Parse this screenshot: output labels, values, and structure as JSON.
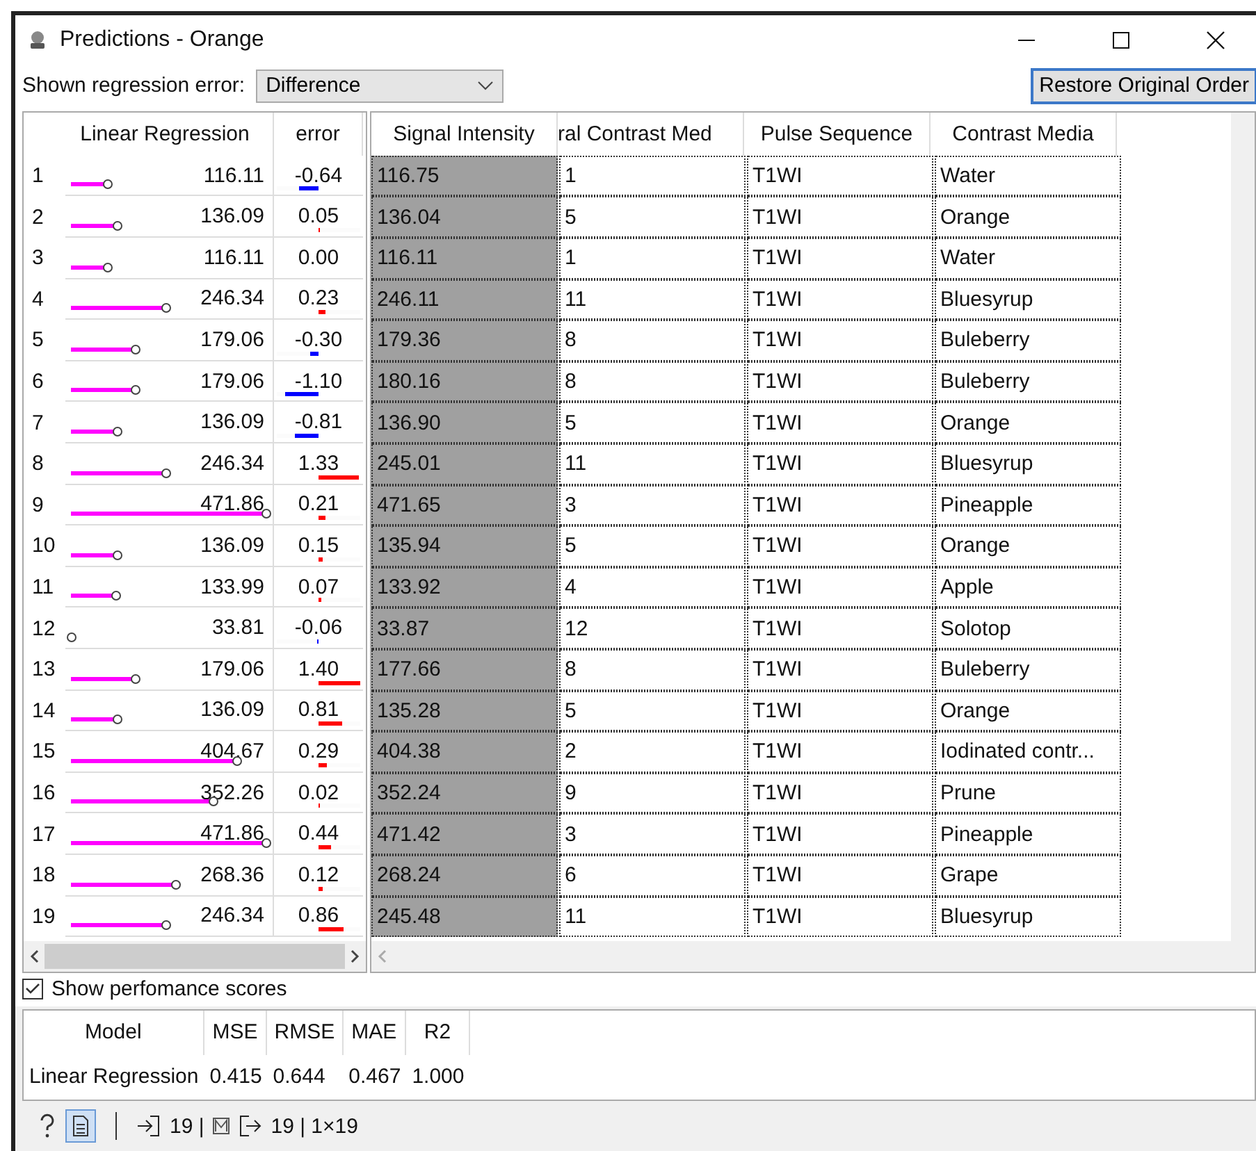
{
  "window": {
    "title": "Predictions - Orange"
  },
  "toolbar": {
    "label": "Shown regression error:",
    "dropdown": "Difference",
    "button": "Restore Original Order"
  },
  "predictions_table": {
    "columns": [
      "Linear Regression",
      "error"
    ],
    "rows": [
      {
        "index": "1",
        "prediction": "116.11",
        "level": 0.188,
        "error": "-0.64",
        "error_bar": {
          "kind": "negative",
          "level": 0.457,
          "color": "#0000ff"
        }
      },
      {
        "index": "2",
        "prediction": "136.09",
        "level": 0.233,
        "error": "0.05",
        "error_bar": {
          "kind": "positive",
          "level": 0.036,
          "color": "#ff0000"
        }
      },
      {
        "index": "3",
        "prediction": "116.11",
        "level": 0.188,
        "error": "0.00"
      },
      {
        "index": "4",
        "prediction": "246.34",
        "level": 0.485,
        "error": "0.23",
        "error_bar": {
          "kind": "positive",
          "level": 0.164,
          "color": "#ff0000"
        }
      },
      {
        "index": "5",
        "prediction": "179.06",
        "level": 0.332,
        "error": "-0.30",
        "error_bar": {
          "kind": "negative",
          "level": 0.214,
          "color": "#0000ff"
        }
      },
      {
        "index": "6",
        "prediction": "179.06",
        "level": 0.332,
        "error": "-1.10",
        "error_bar": {
          "kind": "negative",
          "level": 0.786,
          "color": "#0000ff"
        }
      },
      {
        "index": "7",
        "prediction": "136.09",
        "level": 0.233,
        "error": "-0.81",
        "error_bar": {
          "kind": "negative",
          "level": 0.579,
          "color": "#0000ff"
        }
      },
      {
        "index": "8",
        "prediction": "246.34",
        "level": 0.485,
        "error": "1.33",
        "error_bar": {
          "kind": "positive",
          "level": 0.95,
          "color": "#ff0000"
        }
      },
      {
        "index": "9",
        "prediction": "471.86",
        "level": 1,
        "error": "0.21",
        "error_bar": {
          "kind": "positive",
          "level": 0.15,
          "color": "#ff0000"
        }
      },
      {
        "index": "10",
        "prediction": "136.09",
        "level": 0.233,
        "error": "0.15",
        "error_bar": {
          "kind": "positive",
          "level": 0.107,
          "color": "#ff0000"
        }
      },
      {
        "index": "11",
        "prediction": "133.99",
        "level": 0.229,
        "error": "0.07",
        "error_bar": {
          "kind": "positive",
          "level": 0.05,
          "color": "#ff0000"
        }
      },
      {
        "index": "12",
        "prediction": "33.81",
        "level": 0,
        "error": "-0.06",
        "error_bar": {
          "kind": "negative",
          "level": 0.043,
          "color": "#0000ff"
        }
      },
      {
        "index": "13",
        "prediction": "179.06",
        "level": 0.332,
        "error": "1.40",
        "error_bar": {
          "kind": "positive",
          "level": 1,
          "color": "#ff0000"
        }
      },
      {
        "index": "14",
        "prediction": "136.09",
        "level": 0.233,
        "error": "0.81",
        "error_bar": {
          "kind": "positive",
          "level": 0.579,
          "color": "#ff0000"
        }
      },
      {
        "index": "15",
        "prediction": "404.67",
        "level": 0.847,
        "error": "0.29",
        "error_bar": {
          "kind": "positive",
          "level": 0.207,
          "color": "#ff0000"
        }
      },
      {
        "index": "16",
        "prediction": "352.26",
        "level": 0.727,
        "error": "0.02",
        "error_bar": {
          "kind": "positive",
          "level": 0.014,
          "color": "#ff0000"
        }
      },
      {
        "index": "17",
        "prediction": "471.86",
        "level": 1,
        "error": "0.44",
        "error_bar": {
          "kind": "positive",
          "level": 0.314,
          "color": "#ff0000"
        }
      },
      {
        "index": "18",
        "prediction": "268.36",
        "level": 0.535,
        "error": "0.12",
        "error_bar": {
          "kind": "positive",
          "level": 0.086,
          "color": "#ff0000"
        }
      },
      {
        "index": "19",
        "prediction": "246.34",
        "level": 0.485,
        "error": "0.86",
        "error_bar": {
          "kind": "positive",
          "level": 0.614,
          "color": "#ff0000"
        }
      }
    ]
  },
  "data_table": {
    "columns": [
      "Signal Intensity",
      "ral Contrast Med",
      "Pulse Sequence",
      "Contrast Media"
    ],
    "rows": [
      {
        "selected": true,
        "cells": [
          "116.75",
          "1",
          "T1WI",
          "Water"
        ]
      },
      {
        "selected": true,
        "cells": [
          "136.04",
          "5",
          "T1WI",
          "Orange"
        ]
      },
      {
        "selected": true,
        "cells": [
          "116.11",
          "1",
          "T1WI",
          "Water"
        ]
      },
      {
        "selected": true,
        "cells": [
          "246.11",
          "11",
          "T1WI",
          "Bluesyrup"
        ]
      },
      {
        "selected": true,
        "cells": [
          "179.36",
          "8",
          "T1WI",
          "Buleberry"
        ]
      },
      {
        "selected": true,
        "cells": [
          "180.16",
          "8",
          "T1WI",
          "Buleberry"
        ]
      },
      {
        "selected": true,
        "cells": [
          "136.90",
          "5",
          "T1WI",
          "Orange"
        ]
      },
      {
        "selected": true,
        "cells": [
          "245.01",
          "11",
          "T1WI",
          "Bluesyrup"
        ]
      },
      {
        "selected": true,
        "cells": [
          "471.65",
          "3",
          "T1WI",
          "Pineapple"
        ]
      },
      {
        "selected": true,
        "cells": [
          "135.94",
          "5",
          "T1WI",
          "Orange"
        ]
      },
      {
        "selected": true,
        "cells": [
          "133.92",
          "4",
          "T1WI",
          "Apple"
        ]
      },
      {
        "selected": true,
        "cells": [
          "33.87",
          "12",
          "T1WI",
          "Solotop"
        ]
      },
      {
        "selected": true,
        "cells": [
          "177.66",
          "8",
          "T1WI",
          "Buleberry"
        ]
      },
      {
        "selected": true,
        "cells": [
          "135.28",
          "5",
          "T1WI",
          "Orange"
        ]
      },
      {
        "selected": true,
        "cells": [
          "404.38",
          "2",
          "T1WI",
          "Iodinated contr..."
        ]
      },
      {
        "selected": true,
        "cells": [
          "352.24",
          "9",
          "T1WI",
          "Prune"
        ]
      },
      {
        "selected": true,
        "cells": [
          "471.42",
          "3",
          "T1WI",
          "Pineapple"
        ]
      },
      {
        "selected": true,
        "cells": [
          "268.24",
          "6",
          "T1WI",
          "Grape"
        ]
      },
      {
        "selected": true,
        "cells": [
          "245.48",
          "11",
          "T1WI",
          "Bluesyrup"
        ]
      }
    ]
  },
  "show_scores": {
    "label": "Show perfomance scores",
    "checked": true
  },
  "scores": {
    "columns": [
      "Model",
      "MSE",
      "RMSE",
      "MAE",
      "R2"
    ],
    "rows": [
      [
        "Linear Regression",
        "0.415",
        "0.644",
        "0.467",
        "1.000"
      ]
    ]
  },
  "status_bar": {
    "input_count": "19 |",
    "output_count": "19 | 1×19"
  }
}
